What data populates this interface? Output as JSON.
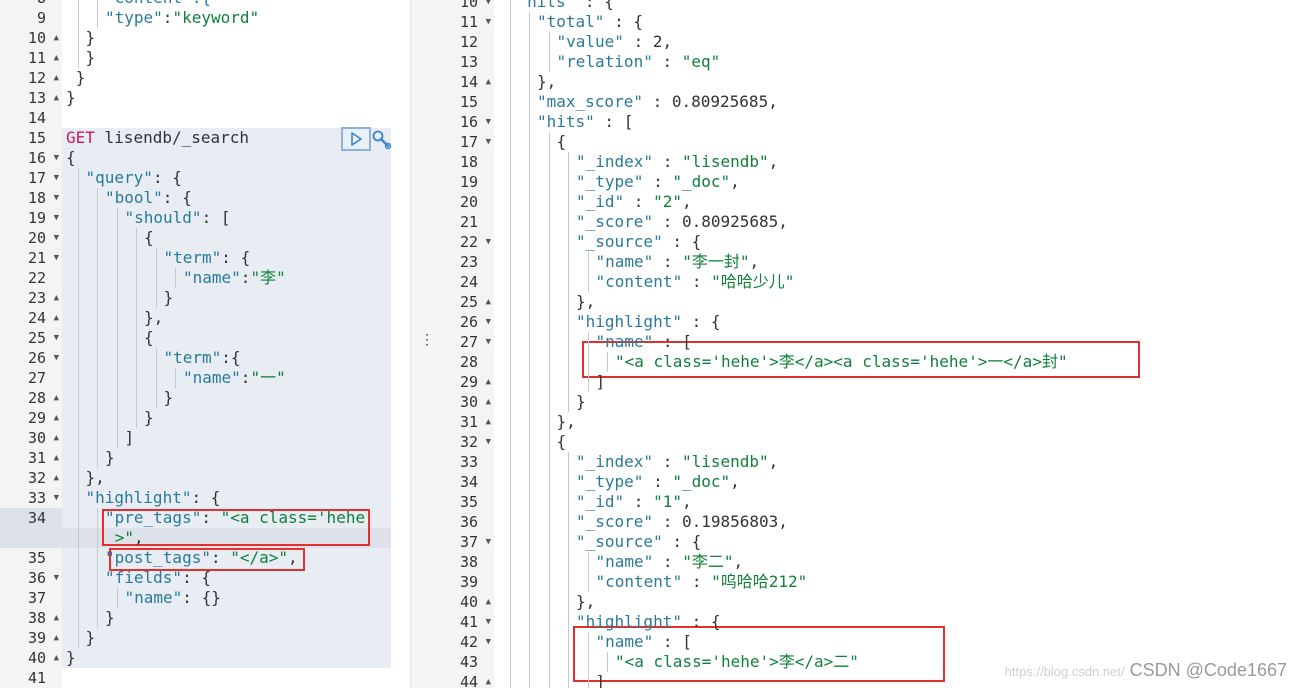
{
  "request": {
    "method": "GET",
    "path": "lisendb/_search",
    "lines": [
      {
        "n": "8",
        "fold": "",
        "ind": 2,
        "frag": "-",
        "segs": [
          [
            "k",
            "\"content\":{"
          ]
        ]
      },
      {
        "n": "9",
        "fold": "",
        "ind": 2,
        "segs": [
          [
            "k",
            "\"type\""
          ],
          [
            "n",
            ":"
          ],
          [
            "s",
            "\"keyword\""
          ]
        ]
      },
      {
        "n": "10",
        "fold": "up",
        "ind": 1,
        "segs": [
          [
            "n",
            "}"
          ]
        ]
      },
      {
        "n": "11",
        "fold": "up",
        "ind": 1,
        "segs": [
          [
            "n",
            "}"
          ]
        ]
      },
      {
        "n": "12",
        "fold": "up",
        "ind": 0.5,
        "segs": [
          [
            "n",
            "}"
          ]
        ]
      },
      {
        "n": "13",
        "fold": "up",
        "ind": 0,
        "segs": [
          [
            "n",
            "}"
          ]
        ]
      },
      {
        "n": "14",
        "fold": "",
        "ind": 0,
        "segs": []
      },
      {
        "n": "15",
        "fold": "",
        "ind": 0,
        "segs": [
          [
            "m",
            "GET"
          ],
          [
            "n",
            " lisendb/_search"
          ]
        ]
      },
      {
        "n": "16",
        "fold": "down",
        "ind": 0,
        "segs": [
          [
            "n",
            "{"
          ]
        ]
      },
      {
        "n": "17",
        "fold": "down",
        "ind": 1,
        "segs": [
          [
            "k",
            "\"query\""
          ],
          [
            "n",
            ": {"
          ]
        ]
      },
      {
        "n": "18",
        "fold": "down",
        "ind": 2,
        "segs": [
          [
            "k",
            "\"bool\""
          ],
          [
            "n",
            ": {"
          ]
        ]
      },
      {
        "n": "19",
        "fold": "down",
        "ind": 3,
        "segs": [
          [
            "k",
            "\"should\""
          ],
          [
            "n",
            ": ["
          ]
        ]
      },
      {
        "n": "20",
        "fold": "down",
        "ind": 4,
        "segs": [
          [
            "n",
            "{"
          ]
        ]
      },
      {
        "n": "21",
        "fold": "down",
        "ind": 5,
        "segs": [
          [
            "k",
            "\"term\""
          ],
          [
            "n",
            ": {"
          ]
        ]
      },
      {
        "n": "22",
        "fold": "",
        "ind": 6,
        "segs": [
          [
            "k",
            "\"name\""
          ],
          [
            "n",
            ":"
          ],
          [
            "s",
            "\"李\""
          ]
        ]
      },
      {
        "n": "23",
        "fold": "up",
        "ind": 5,
        "segs": [
          [
            "n",
            "}"
          ]
        ]
      },
      {
        "n": "24",
        "fold": "up",
        "ind": 4,
        "segs": [
          [
            "n",
            "},"
          ]
        ]
      },
      {
        "n": "25",
        "fold": "down",
        "ind": 4,
        "segs": [
          [
            "n",
            "{"
          ]
        ]
      },
      {
        "n": "26",
        "fold": "down",
        "ind": 5,
        "segs": [
          [
            "k",
            "\"term\""
          ],
          [
            "n",
            ":{"
          ]
        ]
      },
      {
        "n": "27",
        "fold": "",
        "ind": 6,
        "segs": [
          [
            "k",
            "\"name\""
          ],
          [
            "n",
            ":"
          ],
          [
            "s",
            "\"一\""
          ]
        ]
      },
      {
        "n": "28",
        "fold": "up",
        "ind": 5,
        "segs": [
          [
            "n",
            "}"
          ]
        ]
      },
      {
        "n": "29",
        "fold": "up",
        "ind": 4,
        "segs": [
          [
            "n",
            "}"
          ]
        ]
      },
      {
        "n": "30",
        "fold": "up",
        "ind": 3,
        "segs": [
          [
            "n",
            "]"
          ]
        ]
      },
      {
        "n": "31",
        "fold": "up",
        "ind": 2,
        "segs": [
          [
            "n",
            "}"
          ]
        ]
      },
      {
        "n": "32",
        "fold": "up",
        "ind": 1,
        "segs": [
          [
            "n",
            "},"
          ]
        ]
      },
      {
        "n": "33",
        "fold": "down",
        "ind": 1,
        "segs": [
          [
            "k",
            "\"highlight\""
          ],
          [
            "n",
            ": {"
          ]
        ]
      },
      {
        "n": "34",
        "fold": "",
        "ind": 2,
        "segs": [
          [
            "k",
            "\"pre_tags\""
          ],
          [
            "n",
            ": "
          ],
          [
            "s",
            "\"<a class='hehe"
          ]
        ]
      },
      {
        "n": "",
        "fold": "",
        "ind": 2.5,
        "segs": [
          [
            "s",
            ">\""
          ],
          [
            "n",
            ","
          ]
        ]
      },
      {
        "n": "35",
        "fold": "",
        "ind": 2,
        "segs": [
          [
            "k",
            "\"post_tags\""
          ],
          [
            "n",
            ": "
          ],
          [
            "s",
            "\"</a>\""
          ],
          [
            "n",
            ","
          ]
        ]
      },
      {
        "n": "36",
        "fold": "down",
        "ind": 2,
        "segs": [
          [
            "k",
            "\"fields\""
          ],
          [
            "n",
            ": {"
          ]
        ]
      },
      {
        "n": "37",
        "fold": "",
        "ind": 3,
        "segs": [
          [
            "k",
            "\"name\""
          ],
          [
            "n",
            ": {}"
          ]
        ]
      },
      {
        "n": "38",
        "fold": "up",
        "ind": 2,
        "segs": [
          [
            "n",
            "}"
          ]
        ]
      },
      {
        "n": "39",
        "fold": "up",
        "ind": 1,
        "segs": [
          [
            "n",
            "}"
          ]
        ]
      },
      {
        "n": "40",
        "fold": "up",
        "ind": 0,
        "segs": [
          [
            "n",
            "}"
          ]
        ]
      },
      {
        "n": "41",
        "fold": "",
        "ind": 0,
        "segs": []
      }
    ]
  },
  "response": {
    "lines": [
      {
        "n": "10",
        "fold": "down",
        "ind": 1,
        "segs": [
          [
            "k",
            "\"hits\""
          ],
          [
            "n",
            " : {"
          ]
        ]
      },
      {
        "n": "11",
        "fold": "down",
        "ind": 2,
        "segs": [
          [
            "k",
            "\"total\""
          ],
          [
            "n",
            " : {"
          ]
        ]
      },
      {
        "n": "12",
        "fold": "",
        "ind": 3,
        "segs": [
          [
            "k",
            "\"value\""
          ],
          [
            "n",
            " : 2,"
          ]
        ]
      },
      {
        "n": "13",
        "fold": "",
        "ind": 3,
        "segs": [
          [
            "k",
            "\"relation\""
          ],
          [
            "n",
            " : "
          ],
          [
            "s",
            "\"eq\""
          ]
        ]
      },
      {
        "n": "14",
        "fold": "up",
        "ind": 2,
        "segs": [
          [
            "n",
            "},"
          ]
        ]
      },
      {
        "n": "15",
        "fold": "",
        "ind": 2,
        "segs": [
          [
            "k",
            "\"max_score\""
          ],
          [
            "n",
            " : 0.80925685,"
          ]
        ]
      },
      {
        "n": "16",
        "fold": "down",
        "ind": 2,
        "segs": [
          [
            "k",
            "\"hits\""
          ],
          [
            "n",
            " : ["
          ]
        ]
      },
      {
        "n": "17",
        "fold": "down",
        "ind": 3,
        "segs": [
          [
            "n",
            "{"
          ]
        ]
      },
      {
        "n": "18",
        "fold": "",
        "ind": 4,
        "segs": [
          [
            "k",
            "\"_index\""
          ],
          [
            "n",
            " : "
          ],
          [
            "s",
            "\"lisendb\""
          ],
          [
            "n",
            ","
          ]
        ]
      },
      {
        "n": "19",
        "fold": "",
        "ind": 4,
        "segs": [
          [
            "k",
            "\"_type\""
          ],
          [
            "n",
            " : "
          ],
          [
            "s",
            "\"_doc\""
          ],
          [
            "n",
            ","
          ]
        ]
      },
      {
        "n": "20",
        "fold": "",
        "ind": 4,
        "segs": [
          [
            "k",
            "\"_id\""
          ],
          [
            "n",
            " : "
          ],
          [
            "s",
            "\"2\""
          ],
          [
            "n",
            ","
          ]
        ]
      },
      {
        "n": "21",
        "fold": "",
        "ind": 4,
        "segs": [
          [
            "k",
            "\"_score\""
          ],
          [
            "n",
            " : 0.80925685,"
          ]
        ]
      },
      {
        "n": "22",
        "fold": "down",
        "ind": 4,
        "segs": [
          [
            "k",
            "\"_source\""
          ],
          [
            "n",
            " : {"
          ]
        ]
      },
      {
        "n": "23",
        "fold": "",
        "ind": 5,
        "segs": [
          [
            "k",
            "\"name\""
          ],
          [
            "n",
            " : "
          ],
          [
            "s",
            "\"李一封\""
          ],
          [
            "n",
            ","
          ]
        ]
      },
      {
        "n": "24",
        "fold": "",
        "ind": 5,
        "segs": [
          [
            "k",
            "\"content\""
          ],
          [
            "n",
            " : "
          ],
          [
            "s",
            "\"哈哈少儿\""
          ]
        ]
      },
      {
        "n": "25",
        "fold": "up",
        "ind": 4,
        "segs": [
          [
            "n",
            "},"
          ]
        ]
      },
      {
        "n": "26",
        "fold": "down",
        "ind": 4,
        "segs": [
          [
            "k",
            "\"highlight\""
          ],
          [
            "n",
            " : {"
          ]
        ]
      },
      {
        "n": "27",
        "fold": "down",
        "ind": 5,
        "segs": [
          [
            "k",
            "\"name\""
          ],
          [
            "n",
            " : ["
          ]
        ]
      },
      {
        "n": "28",
        "fold": "",
        "ind": 6,
        "segs": [
          [
            "s",
            "\"<a class='hehe'>李</a><a class='hehe'>一</a>封\""
          ]
        ]
      },
      {
        "n": "29",
        "fold": "up",
        "ind": 5,
        "segs": [
          [
            "n",
            "]"
          ]
        ]
      },
      {
        "n": "30",
        "fold": "up",
        "ind": 4,
        "segs": [
          [
            "n",
            "}"
          ]
        ]
      },
      {
        "n": "31",
        "fold": "up",
        "ind": 3,
        "segs": [
          [
            "n",
            "},"
          ]
        ]
      },
      {
        "n": "32",
        "fold": "down",
        "ind": 3,
        "segs": [
          [
            "n",
            "{"
          ]
        ]
      },
      {
        "n": "33",
        "fold": "",
        "ind": 4,
        "segs": [
          [
            "k",
            "\"_index\""
          ],
          [
            "n",
            " : "
          ],
          [
            "s",
            "\"lisendb\""
          ],
          [
            "n",
            ","
          ]
        ]
      },
      {
        "n": "34",
        "fold": "",
        "ind": 4,
        "segs": [
          [
            "k",
            "\"_type\""
          ],
          [
            "n",
            " : "
          ],
          [
            "s",
            "\"_doc\""
          ],
          [
            "n",
            ","
          ]
        ]
      },
      {
        "n": "35",
        "fold": "",
        "ind": 4,
        "segs": [
          [
            "k",
            "\"_id\""
          ],
          [
            "n",
            " : "
          ],
          [
            "s",
            "\"1\""
          ],
          [
            "n",
            ","
          ]
        ]
      },
      {
        "n": "36",
        "fold": "",
        "ind": 4,
        "segs": [
          [
            "k",
            "\"_score\""
          ],
          [
            "n",
            " : 0.19856803,"
          ]
        ]
      },
      {
        "n": "37",
        "fold": "down",
        "ind": 4,
        "segs": [
          [
            "k",
            "\"_source\""
          ],
          [
            "n",
            " : {"
          ]
        ]
      },
      {
        "n": "38",
        "fold": "",
        "ind": 5,
        "segs": [
          [
            "k",
            "\"name\""
          ],
          [
            "n",
            " : "
          ],
          [
            "s",
            "\"李二\""
          ],
          [
            "n",
            ","
          ]
        ]
      },
      {
        "n": "39",
        "fold": "",
        "ind": 5,
        "segs": [
          [
            "k",
            "\"content\""
          ],
          [
            "n",
            " : "
          ],
          [
            "s",
            "\"呜哈哈212\""
          ]
        ]
      },
      {
        "n": "40",
        "fold": "up",
        "ind": 4,
        "segs": [
          [
            "n",
            "},"
          ]
        ]
      },
      {
        "n": "41",
        "fold": "down",
        "ind": 4,
        "segs": [
          [
            "k",
            "\"highlight\""
          ],
          [
            "n",
            " : {"
          ]
        ]
      },
      {
        "n": "42",
        "fold": "down",
        "ind": 5,
        "segs": [
          [
            "k",
            "\"name\""
          ],
          [
            "n",
            " : ["
          ]
        ]
      },
      {
        "n": "43",
        "fold": "",
        "ind": 6,
        "segs": [
          [
            "s",
            "\"<a class='hehe'>李</a>二\""
          ]
        ]
      },
      {
        "n": "44",
        "fold": "up",
        "ind": 5,
        "segs": [
          [
            "n",
            "]"
          ]
        ]
      }
    ]
  },
  "icons": {
    "run": "play-icon",
    "settings": "wrench-icon",
    "divider_handle": "vertical-dots-icon",
    "fold_expanded": "chevron-down-icon",
    "fold_collapse": "chevron-up-icon"
  },
  "colors": {
    "keyword": "#2a7a99",
    "string": "#11803a",
    "method": "#c51e5a",
    "highlight_box": "#e03030"
  },
  "watermark": {
    "faint": "https://blog.csdn.net/",
    "text": "CSDN @Code1667"
  }
}
